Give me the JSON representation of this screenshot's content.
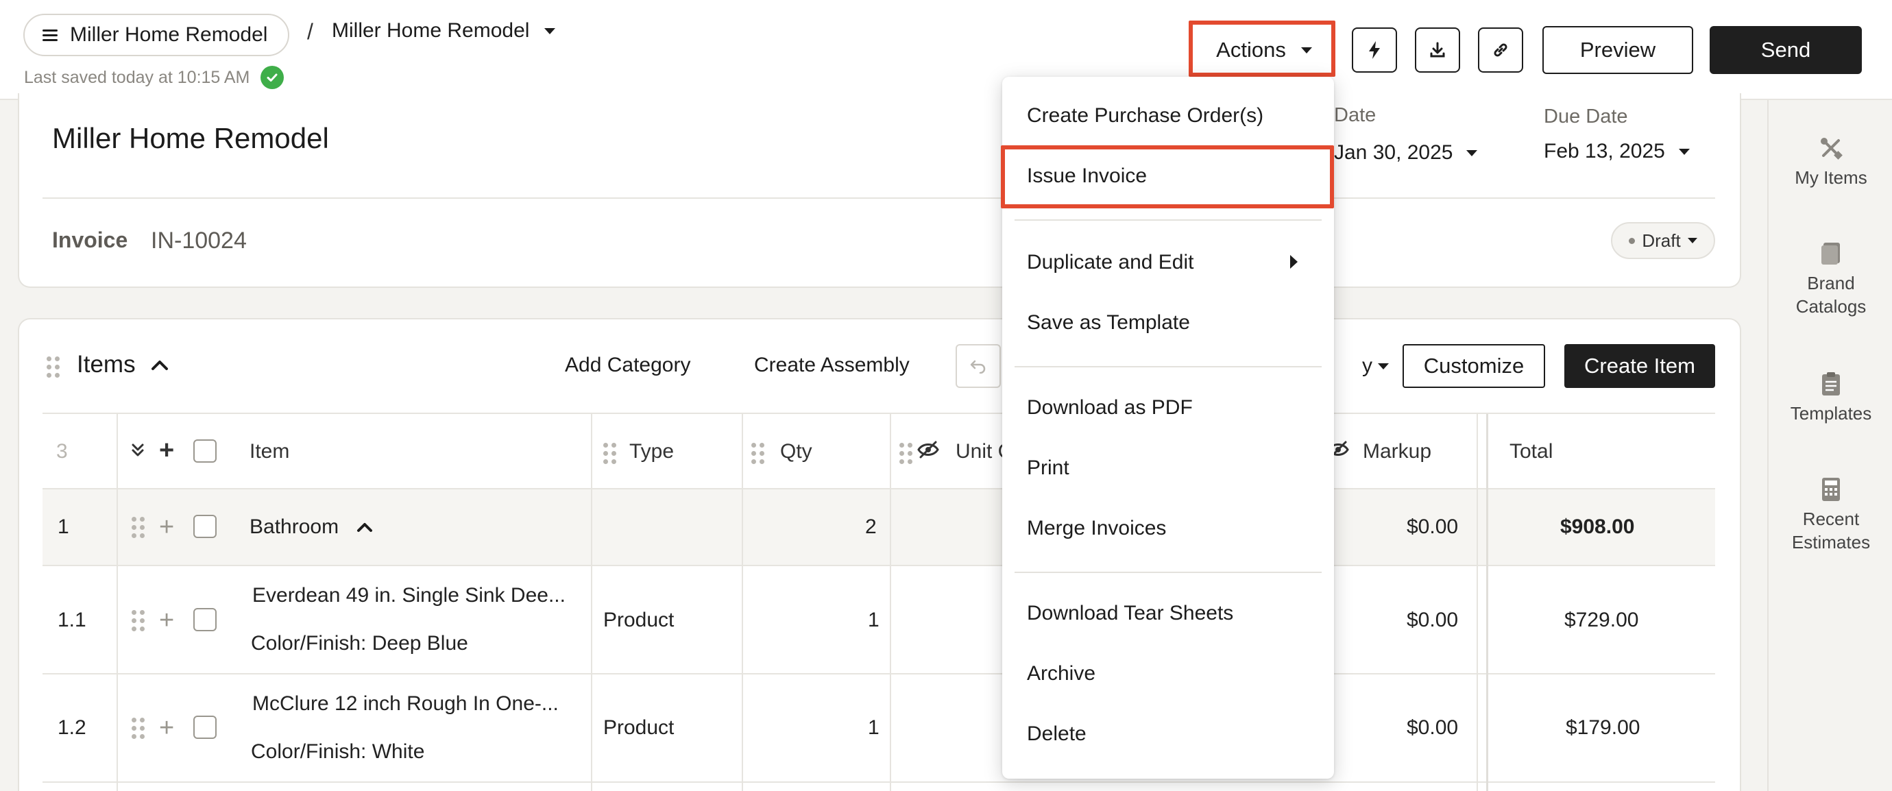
{
  "header": {
    "project_pill": "Miller Home Remodel",
    "breadcrumb_separator": "/",
    "breadcrumb_current": "Miller Home Remodel",
    "saved_status": "Last saved today at 10:15 AM",
    "actions_label": "Actions",
    "preview_label": "Preview",
    "send_label": "Send"
  },
  "document": {
    "title": "Miller Home Remodel",
    "type_label": "Invoice",
    "number": "IN-10024",
    "issue_date_label": "Date",
    "issue_date": "Jan 30, 2025",
    "due_date_label": "Due Date",
    "due_date": "Feb 13, 2025",
    "status": "Draft"
  },
  "rail": {
    "items": [
      {
        "label": "My Items",
        "icon": "tools-icon"
      },
      {
        "label": "Brand Catalogs",
        "icon": "book-icon"
      },
      {
        "label": "Templates",
        "icon": "clipboard-icon"
      },
      {
        "label": "Recent Estimates",
        "icon": "calculator-icon"
      }
    ]
  },
  "items_section": {
    "title": "Items",
    "add_category": "Add Category",
    "create_assembly": "Create Assembly",
    "customize": "Customize",
    "create_item": "Create Item",
    "columns": {
      "count": "3",
      "item": "Item",
      "type": "Type",
      "qty": "Qty",
      "unit": "Unit C",
      "markup": "Markup",
      "total": "Total"
    },
    "rows": [
      {
        "num": "1",
        "item": "Bathroom",
        "sub": "",
        "type": "",
        "qty": "2",
        "markup": "$0.00",
        "total": "$908.00"
      },
      {
        "num": "1.1",
        "item": "Everdean 49 in. Single Sink Dee...",
        "sub": "Color/Finish: Deep Blue",
        "type": "Product",
        "qty": "1",
        "markup": "$0.00",
        "total": "$729.00"
      },
      {
        "num": "1.2",
        "item": "McClure 12 inch Rough In One-...",
        "sub": "Color/Finish: White",
        "type": "Product",
        "qty": "1",
        "markup": "$0.00",
        "total": "$179.00"
      }
    ]
  },
  "actions_menu": {
    "items": [
      "Create Purchase Order(s)",
      "Issue Invoice",
      "Duplicate and Edit",
      "Save as Template",
      "Download as PDF",
      "Print",
      "Merge Invoices",
      "Download Tear Sheets",
      "Archive",
      "Delete"
    ]
  },
  "colors": {
    "highlight": "#e34a2f",
    "primary_dark": "#1f1f1f",
    "success": "#3fae49"
  }
}
